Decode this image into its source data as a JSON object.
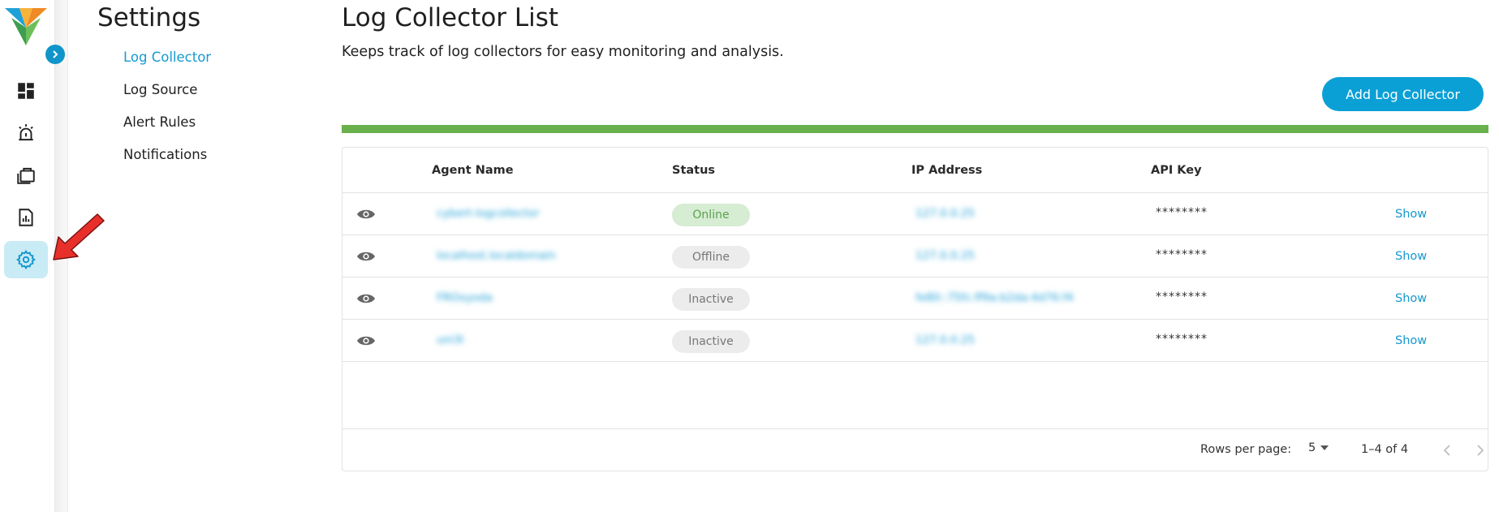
{
  "settings": {
    "title": "Settings",
    "nav": [
      {
        "label": "Log Collector",
        "active": true
      },
      {
        "label": "Log Source",
        "active": false
      },
      {
        "label": "Alert Rules",
        "active": false
      },
      {
        "label": "Notifications",
        "active": false
      }
    ]
  },
  "rail": {
    "icons": [
      "dashboard-icon",
      "alarm-icon",
      "briefcase-icon",
      "report-icon",
      "gear-icon"
    ],
    "active": "gear-icon"
  },
  "main": {
    "title": "Log Collector List",
    "subtitle": "Keeps track of log collectors for easy monitoring and analysis.",
    "add_button": "Add Log Collector",
    "progress": 1.0
  },
  "table": {
    "headers": {
      "agent": "Agent Name",
      "status": "Status",
      "ip": "IP Address",
      "key": "API Key"
    },
    "rows": [
      {
        "agent": "cybert-logcollector",
        "status": "Online",
        "ip": "127.0.0.25",
        "key": "********",
        "action": "Show"
      },
      {
        "agent": "localhost.localdomain",
        "status": "Offline",
        "ip": "127.0.0.25",
        "key": "********",
        "action": "Show"
      },
      {
        "agent": "FROxyoda",
        "status": "Inactive",
        "ip": "fe80::75fc:ff9a:b2da:4d76:f4",
        "key": "********",
        "action": "Show"
      },
      {
        "agent": "uni3l",
        "status": "Inactive",
        "ip": "127.0.0.25",
        "key": "********",
        "action": "Show"
      }
    ],
    "footer": {
      "rows_per_page_label": "Rows per page:",
      "rows_per_page": "5",
      "range": "1–4 of 4"
    }
  },
  "colors": {
    "accent": "#0aa0d6",
    "progress": "#6ab04c",
    "online_bg": "#d6ecd3",
    "online_text": "#58a24b",
    "neutral_chip": "#ececec"
  }
}
